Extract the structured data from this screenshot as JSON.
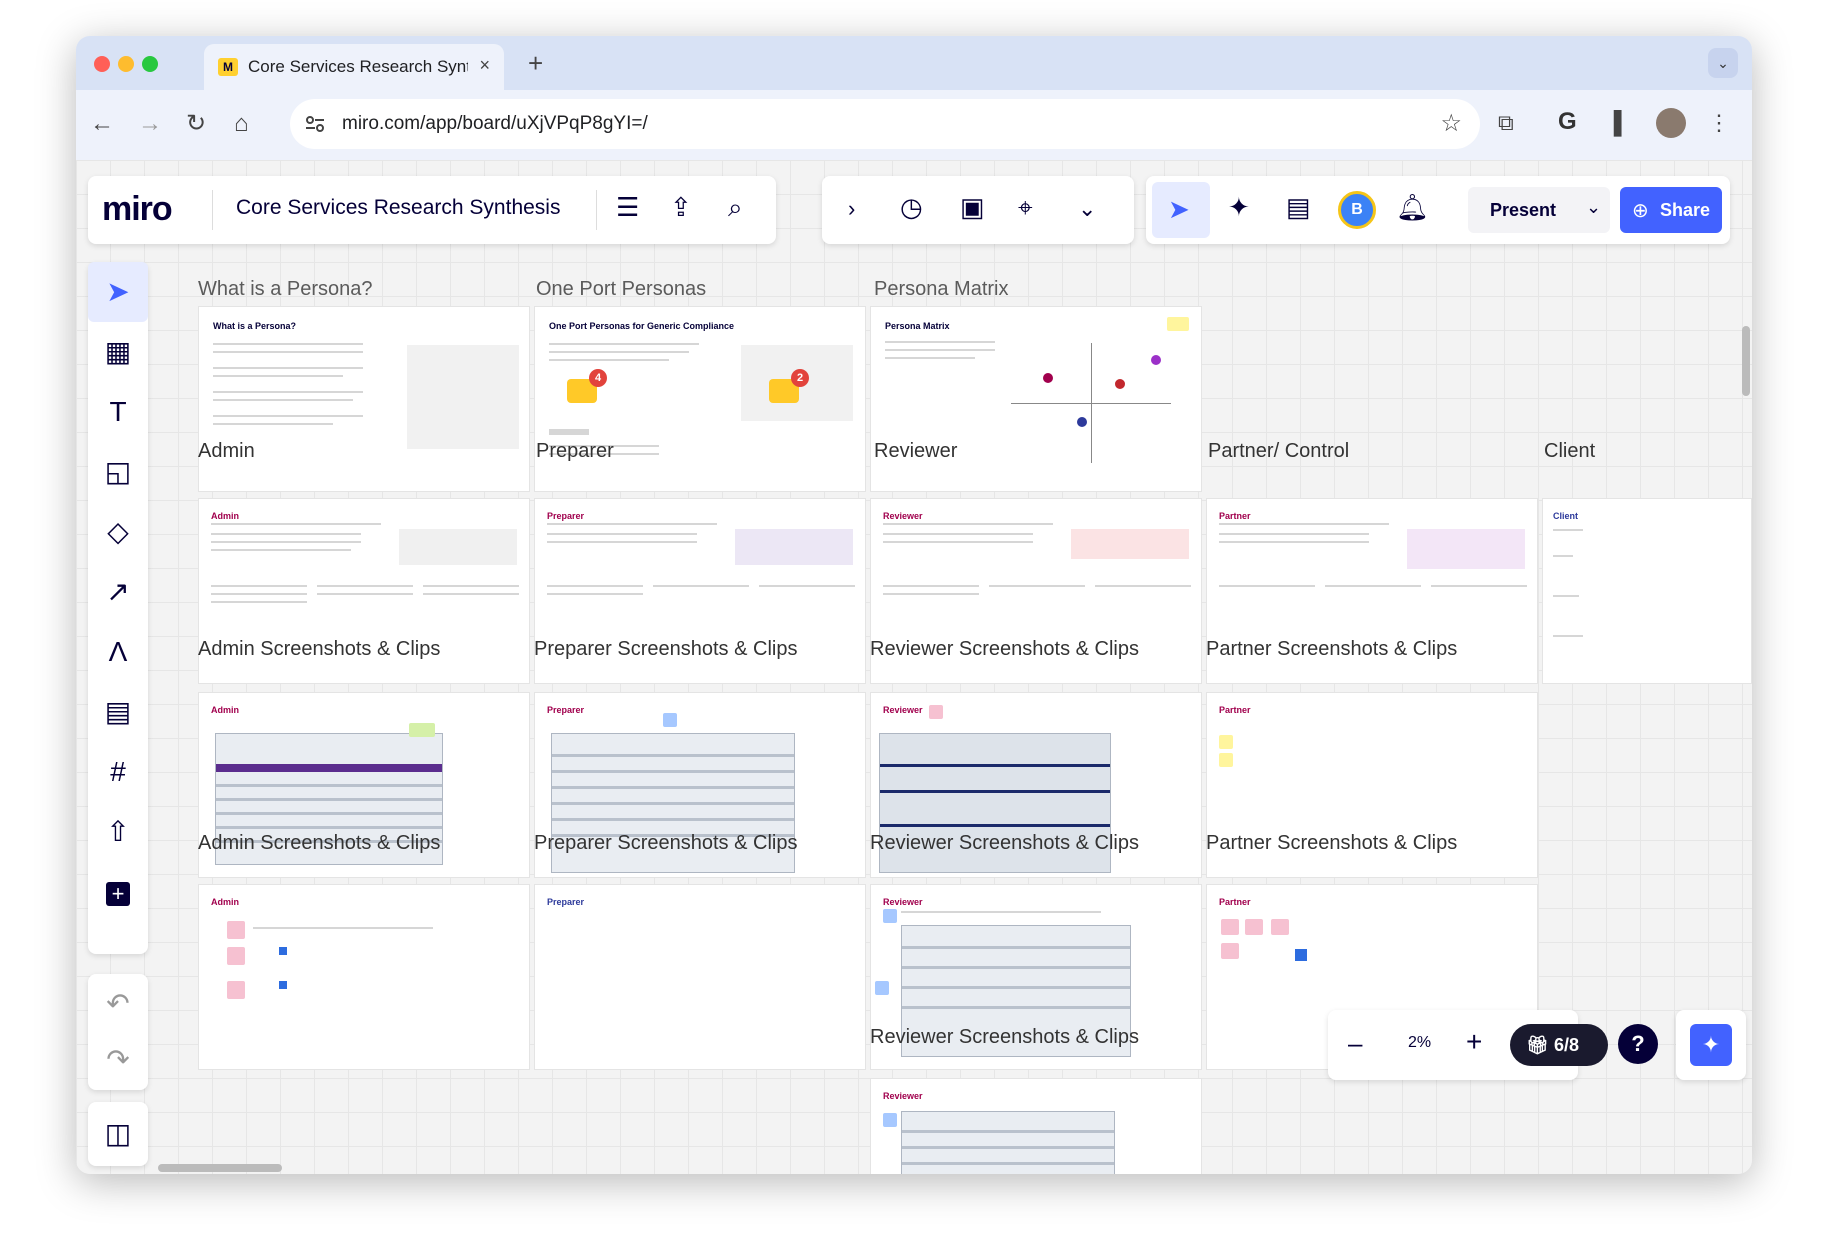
{
  "browser": {
    "tab_title": "Core Services Research Synt",
    "url": "miro.com/app/board/uXjVPqP8gYI=/",
    "tab_close": "×",
    "new_tab": "+",
    "profile_letter": "G"
  },
  "miro": {
    "logo": "miro",
    "board_title": "Core Services Research Synthesis",
    "avatar_letter": "B",
    "present_label": "Present",
    "share_label": "Share",
    "zoom_level": "2%",
    "gift_counter": "6/8",
    "help": "?"
  },
  "board": {
    "column_headers": [
      "What is a Persona?",
      "One Port Personas",
      "Persona Matrix"
    ],
    "row1_labels": [
      "Admin",
      "Preparer",
      "Reviewer",
      "Partner/ Control",
      "Client"
    ],
    "row2_labels": [
      "Admin Screenshots & Clips",
      "Preparer Screenshots & Clips",
      "Reviewer Screenshots & Clips",
      "Partner Screenshots & Clips"
    ],
    "row3_labels": [
      "Admin Screenshots & Clips",
      "Preparer Screenshots & Clips",
      "Reviewer Screenshots & Clips",
      "Partner Screenshots & Clips"
    ],
    "row4_labels": [
      "Reviewer Screenshots & Clips"
    ],
    "card_titles": {
      "what_is": "What is a Persona?",
      "one_port": "One Port Personas for Generic Compliance",
      "matrix": "Persona Matrix",
      "admin": "Admin",
      "preparer": "Preparer",
      "reviewer": "Reviewer",
      "partner": "Partner",
      "client": "Client"
    },
    "badges": [
      "4",
      "2"
    ]
  },
  "colors": {
    "miro_blue": "#4262ff",
    "miro_yellow": "#ffd02f",
    "persona_tag": "#a1004d",
    "board_bg": "#f3f3f3"
  },
  "icons": [
    "back-arrow-icon",
    "forward-arrow-icon",
    "reload-icon",
    "home-icon",
    "star-icon",
    "extensions-icon",
    "menu-icon",
    "export-icon",
    "search-icon",
    "timer-icon",
    "cursor-icon",
    "comment-icon",
    "bell-icon",
    "globe-icon",
    "sparkle-icon"
  ]
}
